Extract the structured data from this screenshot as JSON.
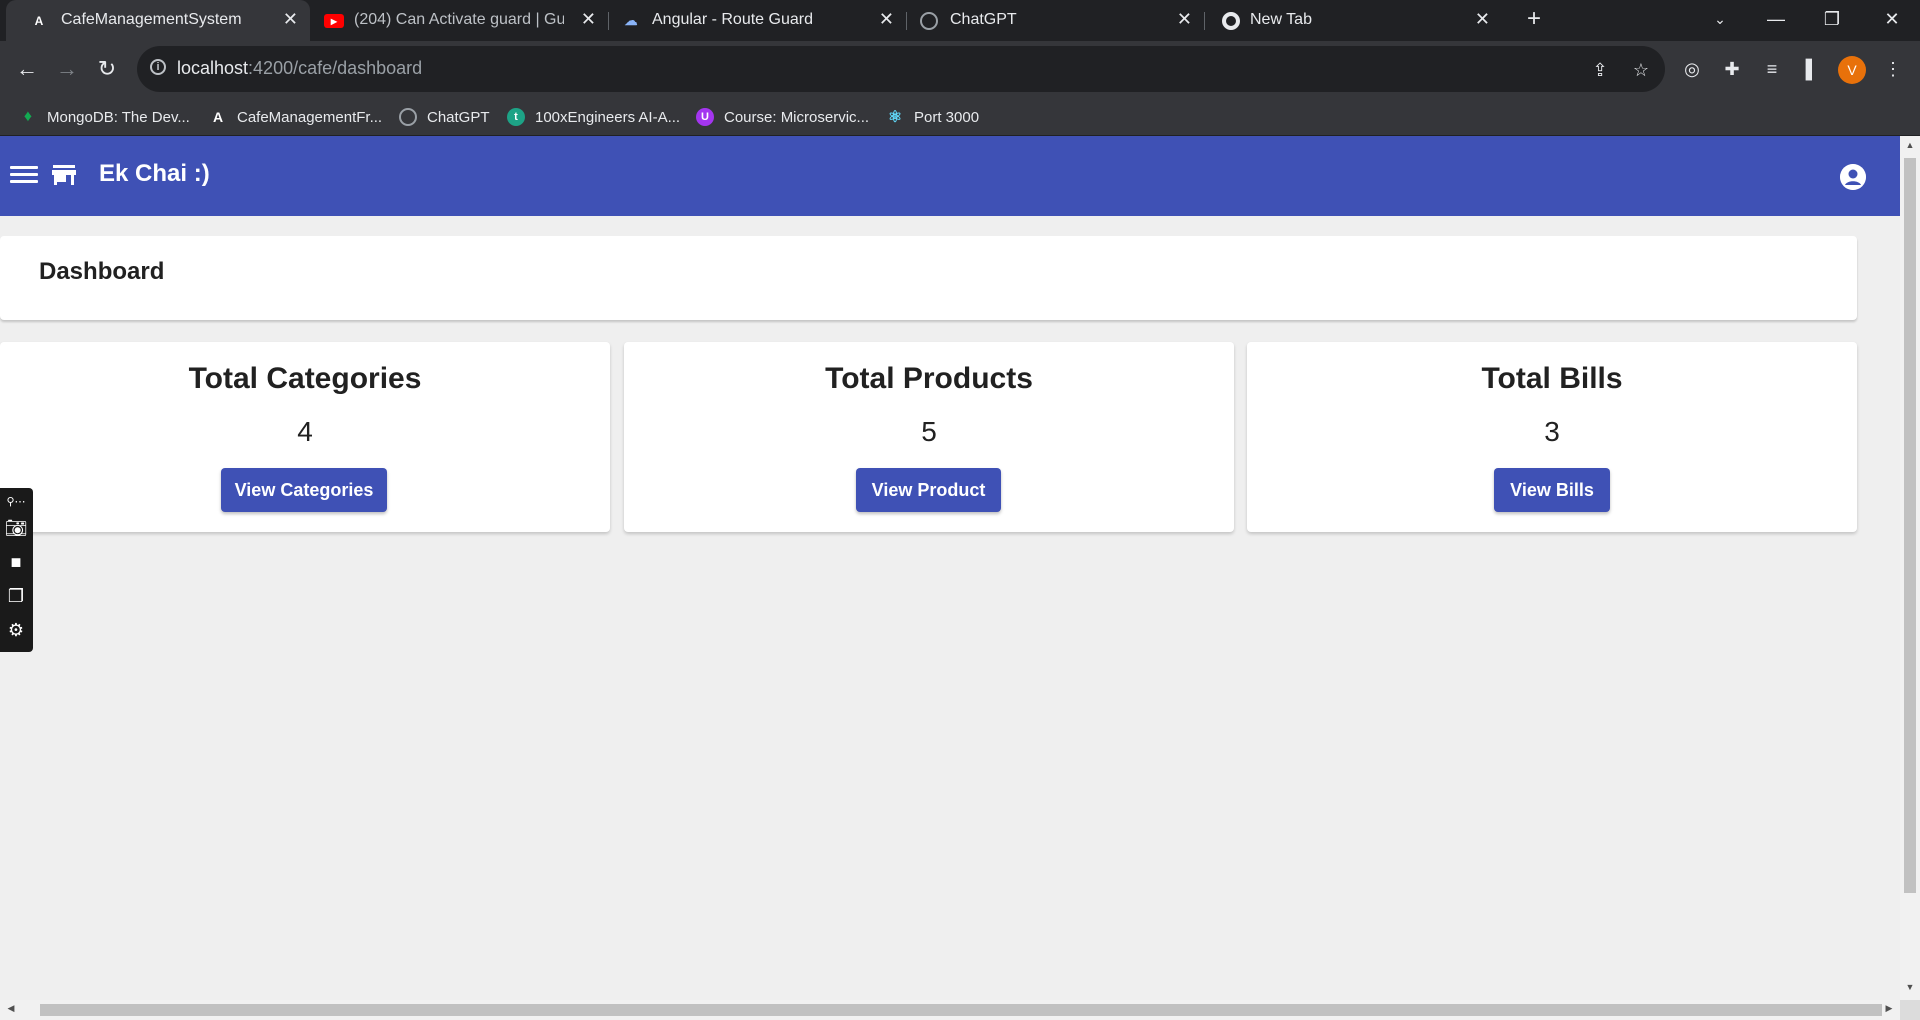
{
  "browser": {
    "tabs": [
      {
        "title": "CafeManagementSystem",
        "favicon": "angular-icon",
        "active": true
      },
      {
        "title": "(204) Can Activate guard | Guard",
        "favicon": "youtube-icon",
        "active": false
      },
      {
        "title": "Angular - Route Guard",
        "favicon": "cloud-icon",
        "active": false
      },
      {
        "title": "ChatGPT",
        "favicon": "chatgpt-icon",
        "active": false
      },
      {
        "title": "New Tab",
        "favicon": "chrome-icon",
        "active": false
      }
    ],
    "url_host": "localhost",
    "url_path": ":4200/cafe/dashboard",
    "profile_initial": "V",
    "bookmarks": [
      {
        "label": "MongoDB: The Dev...",
        "icon": "mongodb-leaf-icon"
      },
      {
        "label": "CafeManagementFr...",
        "icon": "angular-icon"
      },
      {
        "label": "ChatGPT",
        "icon": "chatgpt-icon"
      },
      {
        "label": "100xEngineers AI-A...",
        "icon": "circle-icon"
      },
      {
        "label": "Course: Microservic...",
        "icon": "udemy-icon"
      },
      {
        "label": "Port 3000",
        "icon": "react-icon"
      }
    ]
  },
  "app": {
    "title": "Ek Chai :)",
    "page_heading": "Dashboard",
    "stats": [
      {
        "title": "Total Categories",
        "count": "4",
        "button": "View Categories"
      },
      {
        "title": "Total Products",
        "count": "5",
        "button": "View Product"
      },
      {
        "title": "Total Bills",
        "count": "3",
        "button": "View Bills"
      }
    ],
    "colors": {
      "primary": "#3f51b5",
      "background": "#efefef"
    }
  }
}
